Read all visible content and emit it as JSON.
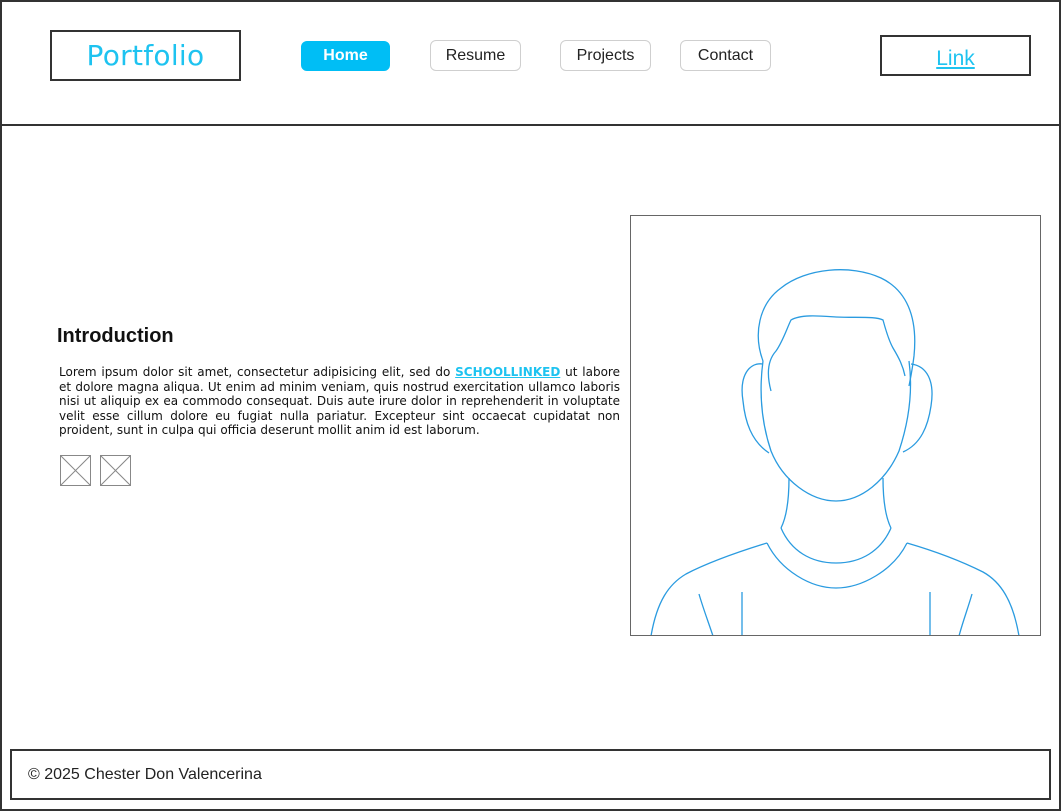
{
  "header": {
    "logo": "Portfolio",
    "nav": [
      {
        "label": "Home",
        "active": true
      },
      {
        "label": "Resume",
        "active": false
      },
      {
        "label": "Projects",
        "active": false
      },
      {
        "label": "Contact",
        "active": false
      }
    ],
    "link": "Link"
  },
  "intro": {
    "title": "Introduction",
    "body_before": "Lorem ipsum dolor sit amet, consectetur adipisicing elit, sed do ",
    "link_text": "SCHOOLLINKED",
    "body_after": " ut labore et dolore magna aliqua. Ut enim ad minim veniam, quis nostrud exercitation ullamco laboris nisi ut aliquip ex ea commodo consequat. Duis aute irure dolor in reprehenderit in voluptate velit esse cillum dolore eu fugiat nulla pariatur. Excepteur sint occaecat cupidatat non proident, sunt in culpa qui officia deserunt mollit anim id est laborum.",
    "social_icons": [
      "image-placeholder-icon",
      "image-placeholder-icon"
    ]
  },
  "portrait": {
    "icon": "user-portrait-icon"
  },
  "footer": {
    "text": "© 2025 Chester Don Valencerina"
  },
  "colors": {
    "accent": "#00bef5",
    "link": "#1ec3f0",
    "border": "#333333",
    "portrait_stroke": "#2a9be0"
  }
}
